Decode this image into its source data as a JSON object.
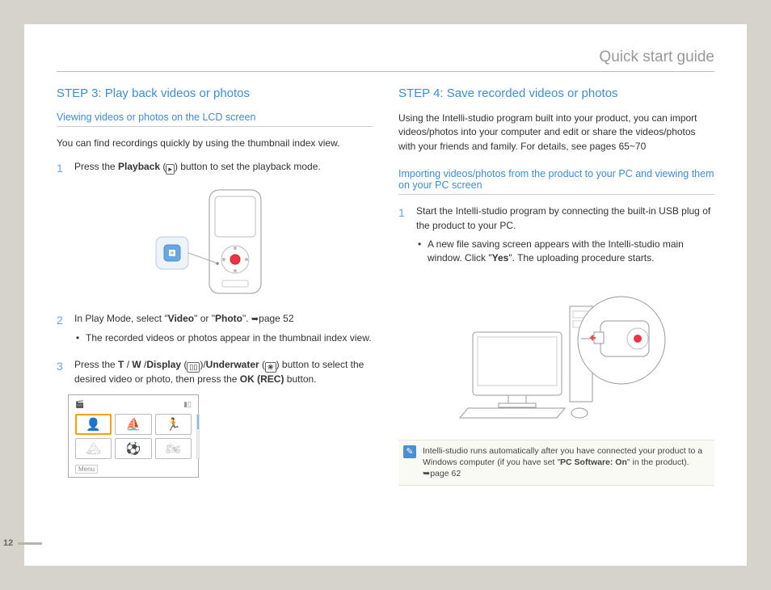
{
  "header": {
    "title": "Quick start guide"
  },
  "page_number": "12",
  "left": {
    "step_title": "STEP 3: Play back videos or photos",
    "subhead": "Viewing videos or photos on the LCD screen",
    "intro": "You can find recordings quickly by using the thumbnail index view.",
    "s1": {
      "num": "1",
      "a": "Press the ",
      "b": "Playback",
      "c": " (",
      "d": ") button to set the playback mode."
    },
    "s2": {
      "num": "2",
      "a": "In Play Mode, select \"",
      "b": "Video",
      "c": "\" or \"",
      "d": "Photo",
      "e": "\". ",
      "ref": "page 52",
      "bullet": "The recorded videos or photos appear in the thumbnail index view."
    },
    "s3": {
      "num": "3",
      "a": "Press the ",
      "b": "T",
      "c": " / ",
      "d": "W",
      "e": " /",
      "f": "Display",
      "g": " (",
      "h": ")/",
      "i": "Underwater",
      "j": " (",
      "k": ") button to select the desired video or photo, then press the ",
      "l": "OK (REC)",
      "m": " button."
    },
    "thumb_menu": "Menu"
  },
  "right": {
    "step_title": "STEP 4: Save recorded videos or photos",
    "intro": "Using the Intelli-studio program built into your product, you can import videos/photos into your computer and edit or share the videos/photos with your friends and family. For details, see pages 65~70",
    "subhead": "Importing videos/photos from the product to your PC and viewing them on your PC screen",
    "s1": {
      "num": "1",
      "text": "Start the Intelli-studio program by connecting the built-in USB plug of the product to your PC.",
      "bullet_a": "A new file saving screen appears with the Intelli-studio main window. Click \"",
      "bullet_b": "Yes",
      "bullet_c": "\". The uploading procedure starts."
    },
    "info": {
      "a": "Intelli-studio runs automatically after you have connected your product to a Windows computer (if you have set \"",
      "b": "PC Software: On",
      "c": "\" in the product). ",
      "ref": "page 62"
    }
  }
}
